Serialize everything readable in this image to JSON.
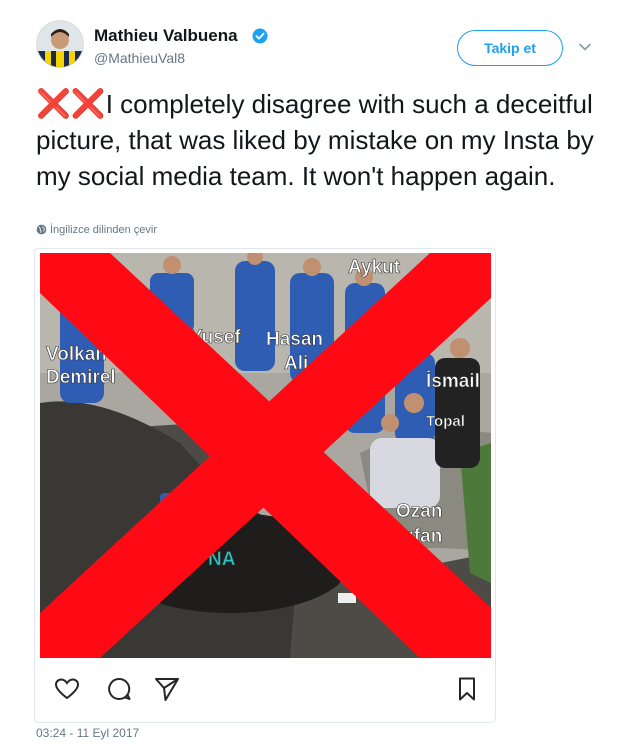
{
  "author": {
    "name": "Mathieu Valbuena",
    "handle": "@MathieuVal8",
    "verified": true,
    "avatar_icon": "avatar-photo-icon"
  },
  "follow_button": {
    "label": "Takip et"
  },
  "tweet": {
    "prefix_marks": "❌❌",
    "text": "I completely disagree with such a deceitful picture, that was liked by mistake on my Insta by my social media team. It won't happen again."
  },
  "translate_link": {
    "label": "İngilizce dilinden çevir",
    "icon": "globe-icon"
  },
  "media": {
    "overlay_icon": "red-x-icon",
    "labels": [
      "Aykut",
      "Volkan",
      "Demirel",
      "Yusef",
      "Hasan",
      "Ali",
      "İsmail",
      "Topal",
      "Ozan",
      "Tufan",
      "NA"
    ],
    "actions": [
      "heart-icon",
      "comment-icon",
      "share-icon",
      "bookmark-icon"
    ]
  },
  "timestamp": "03:24 - 11 Eyl 2017",
  "colors": {
    "brand_blue": "#1da1f2",
    "text": "#14171a",
    "muted": "#657786",
    "cross_red": "#ff0a14"
  }
}
